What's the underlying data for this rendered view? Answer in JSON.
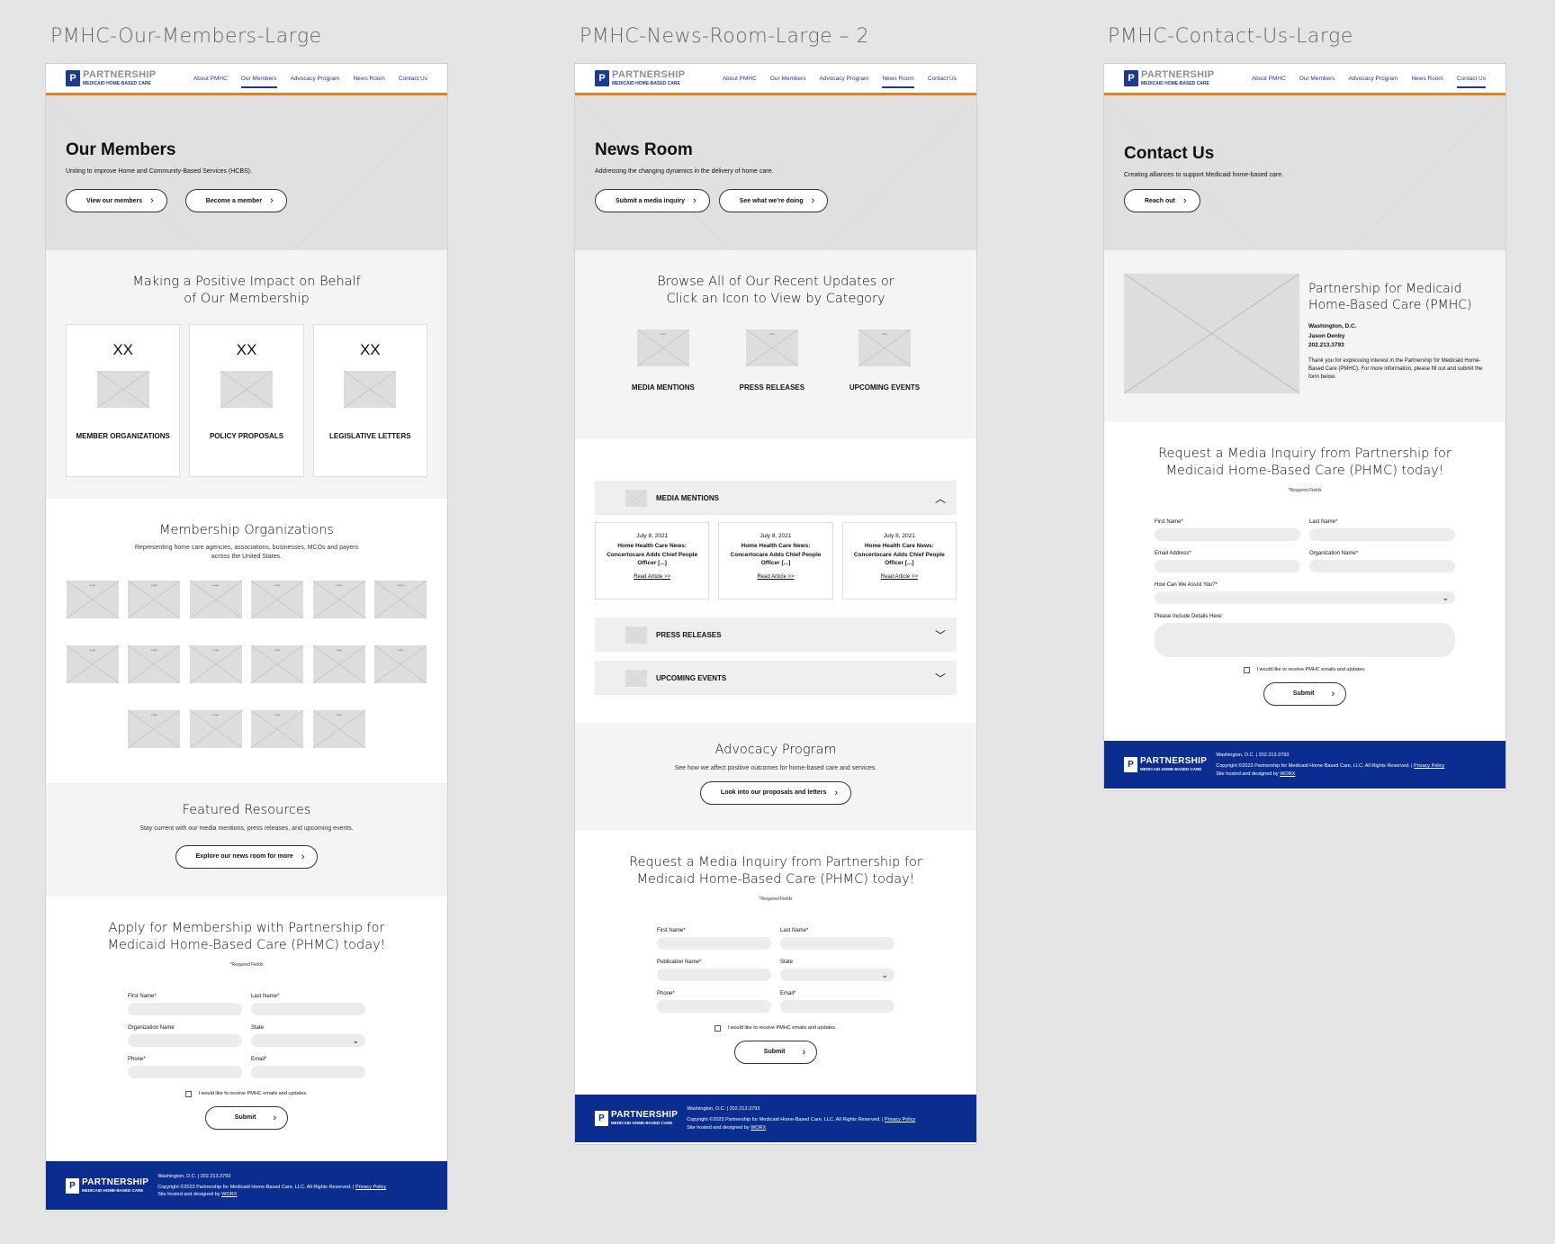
{
  "canvas": {
    "frames": [
      {
        "label": "PMHC-Our-Members-Large"
      },
      {
        "label": "PMHC-News-Room-Large – 2"
      },
      {
        "label": "PMHC-Contact-Us-Large"
      }
    ]
  },
  "brand": {
    "logo_top": "PARTNERSHIP",
    "logo_bottom": "MEDICAID HOME-BASED CARE",
    "logo_mark": "P",
    "nav": [
      "About PMHC",
      "Our Members",
      "Advocacy Program",
      "News Room",
      "Contact Us"
    ],
    "primary_color": "#1c3b8f",
    "accent_color": "#e87f1e",
    "footer_color": "#0b2d8f"
  },
  "footer": {
    "address": "Washington, D.C. | 202.213.3793",
    "copyright": "Copyright ©2023 Partnership for Medicaid Home-Based Care, LLC. All Rights Reserved. |",
    "privacy": "Privacy Policy",
    "hosted": "Site hosted and designed by",
    "worx": "WORX"
  },
  "members": {
    "hero_title": "Our Members",
    "hero_sub": "Uniting to improve Home and Community-Based Services (HCBS).",
    "btn1": "View our members",
    "btn2": "Become a member",
    "impact_title": "Making a Positive Impact on Behalf of Our Membership",
    "cards": [
      {
        "xx": "XX",
        "label": "MEMBER ORGANIZATIONS"
      },
      {
        "xx": "XX",
        "label": "POLICY PROPOSALS"
      },
      {
        "xx": "XX",
        "label": "LEGISLATIVE LETTERS"
      }
    ],
    "orgs_title": "Membership Organizations",
    "orgs_sub": "Representing home care agencies, associations, businesses, MCOs and payers across the United States.",
    "logo_count": 16,
    "logo_label": "Logo",
    "res_title": "Featured Resources",
    "res_sub": "Stay current with our media mentions, press releases, and upcoming events.",
    "res_btn": "Explore our news room for more",
    "apply_title": "Apply for Membership with Partnership for Medicaid Home-Based Care (PHMC) today!",
    "required": "*Required Fields",
    "f_first": "First Name*",
    "f_last": "Last Name*",
    "f_org": "Organization Name",
    "f_state": "State",
    "f_phone": "Phone*",
    "f_email": "Email*",
    "optin": "I would like to receive PMHC emails and updates.",
    "submit": "Submit"
  },
  "news": {
    "hero_title": "News Room",
    "hero_sub": "Addressing the changing dynamics in the delivery of home care.",
    "btn1": "Submit a media inquiry",
    "btn2": "See what we're doing",
    "browse_title": "Browse All of Our Recent Updates or Click an Icon to View by Category",
    "icon_label": "Icon",
    "cats": [
      "MEDIA MENTIONS",
      "PRESS RELEASES",
      "UPCOMING EVENTS"
    ],
    "acc": [
      "MEDIA MENTIONS",
      "PRESS RELEASES",
      "UPCOMING EVENTS"
    ],
    "items": [
      {
        "date": "July 8, 2021",
        "title": "Home Health Care News: Concertocare Adds Chief People Officer [...]",
        "link": "Read Article >>"
      },
      {
        "date": "July 8, 2021",
        "title": "Home Health Care News: Concertocare Adds Chief People Officer [...]",
        "link": "Read Article >>"
      },
      {
        "date": "July 8, 2021",
        "title": "Home Health Care News: Concertocare Adds Chief People Officer [...]",
        "link": "Read Article >>"
      }
    ],
    "adv_title": "Advocacy Program",
    "adv_sub": "See how we affect positive outcomes for home-based care and services.",
    "adv_btn": "Look into our proposals and letters",
    "req_title": "Request a Media Inquiry from Partnership for Medicaid Home-Based Care (PHMC) today!",
    "required": "*Required Fields",
    "f_first": "First Name*",
    "f_last": "Last Name*",
    "f_pub": "Publication Name*",
    "f_state": "State",
    "f_phone": "Phone*",
    "f_email": "Email*",
    "optin": "I would like to receive PMHC emails and updates.",
    "submit": "Submit"
  },
  "contact": {
    "hero_title": "Contact Us",
    "hero_sub": "Creating alliances to support Medicaid home-based care.",
    "btn1": "Reach out",
    "org_title": "Partnership for Medicaid Home-Based Care (PMHC)",
    "loc": "Washington, D.C.",
    "person": "Jason Denby",
    "phone": "202.213.3793",
    "thanks": "Thank you for expressing interest in the Partnership for Medicaid Home-Based Care (PMHC). For more information, please fill out and submit the form below.",
    "req_title": "Request a Media Inquiry from Partnership for Medicaid Home-Based Care (PHMC) today!",
    "required": "*Required Fields",
    "f_first": "First Name*",
    "f_last": "Last Name*",
    "f_email": "Email Address*",
    "f_org": "Organization Name*",
    "f_assist": "How Can We Assist You?*",
    "f_details": "Please Include Details Here:",
    "optin": "I would like to receive PMHC emails and updates.",
    "submit": "Submit"
  }
}
